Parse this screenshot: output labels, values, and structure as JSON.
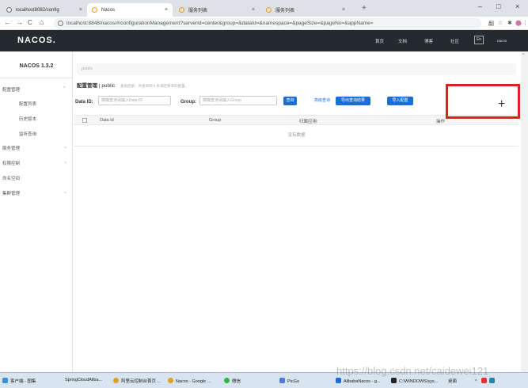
{
  "browser": {
    "tabs": [
      {
        "label": "localhost8082/config",
        "active": false
      },
      {
        "label": "Nacos",
        "active": true
      },
      {
        "label": "服务列表",
        "active": false
      },
      {
        "label": "服务列表",
        "active": false
      }
    ],
    "new_tab": "+",
    "window_controls": {
      "minimize": "–",
      "maximize": "□",
      "close": "×"
    },
    "nav": {
      "back": "←",
      "forward": "→",
      "reload": "C",
      "home": "⌂"
    },
    "url": "localhost:8848/nacos/#/configurationManagement?serverId=center&group=&dataId=&namespace=&pageSize=&pageNo=&appName=",
    "extensions": [
      "翻",
      "☆",
      "✱",
      "⬤",
      "⋮"
    ]
  },
  "app": {
    "logo": "NACOS.",
    "nav": [
      "首页",
      "文档",
      "博客",
      "社区"
    ],
    "lang": "En",
    "user": "nacos"
  },
  "sidebar": {
    "title": "NACOS 1.3.2",
    "items": [
      {
        "label": "配置管理",
        "chevron": "^"
      },
      {
        "label": "配置列表"
      },
      {
        "label": "历史版本"
      },
      {
        "label": "监听查询"
      },
      {
        "label": "服务管理",
        "chevron": "⌄"
      },
      {
        "label": "权限控制",
        "chevron": "⌄"
      },
      {
        "label": "命名空间"
      },
      {
        "label": "集群管理",
        "chevron": "⌄"
      }
    ]
  },
  "main": {
    "breadcrumb": "public",
    "page_title": "配置管理",
    "namespace": "public",
    "hint": "查询结果：共查询到 0 条满足要求的配置。",
    "filters": {
      "dataid_label": "Data ID:",
      "dataid_placeholder": "模糊查询请输入Data ID",
      "group_label": "Group:",
      "group_placeholder": "模糊查询请输入Group"
    },
    "buttons": {
      "search": "查询",
      "advanced": "高级查询",
      "export": "导出查询结果",
      "import": "导入配置"
    },
    "table": {
      "columns": [
        "Data Id",
        "Group",
        "归属应用:",
        "操作"
      ],
      "empty": "没有数据"
    },
    "add_icon": "+"
  },
  "taskbar": {
    "items": [
      "客户端 - 图集",
      "SpringCloudAliba...",
      "阿里云控制台首页 ...",
      "Nacos - Google ...",
      "微信",
      "PicGo",
      "AlibabaNacos - g...",
      "C:\\WINDOWS\\sys...",
      "桌面"
    ]
  },
  "watermark": "https://blog.csdn.net/caidewei121"
}
